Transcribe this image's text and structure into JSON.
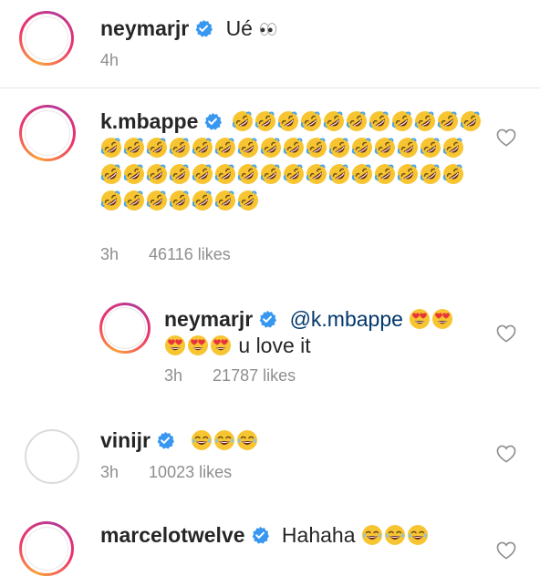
{
  "comments": [
    {
      "username": "neymarjr",
      "verified": true,
      "text": "Ué",
      "emoji": [
        "eyes",
        "eyes"
      ],
      "time": "4h",
      "likes": ""
    },
    {
      "username": "k.mbappe",
      "verified": true,
      "text": "",
      "emoji_count": 50,
      "emoji_name": "rolling-on-the-floor-laughing",
      "time": "3h",
      "likes": "46116 likes"
    },
    {
      "username": "neymarjr",
      "verified": true,
      "mention": "@k.mbappe",
      "text_after": "u love it",
      "emoji_name": "heart-eyes",
      "time": "3h",
      "likes": "21787 likes",
      "is_reply": true
    },
    {
      "username": "vinijr",
      "verified": true,
      "text": "",
      "emoji_name": "tears-of-joy",
      "time": "3h",
      "likes": "10023 likes"
    },
    {
      "username": "marcelotwelve",
      "verified": true,
      "text": "Hahaha",
      "emoji_name": "tears-of-joy",
      "time": "",
      "likes": ""
    }
  ],
  "colors": {
    "verified_blue": "#3897f0",
    "text_primary": "#262626",
    "text_secondary": "#8e8e8e",
    "mention": "#00376b"
  }
}
